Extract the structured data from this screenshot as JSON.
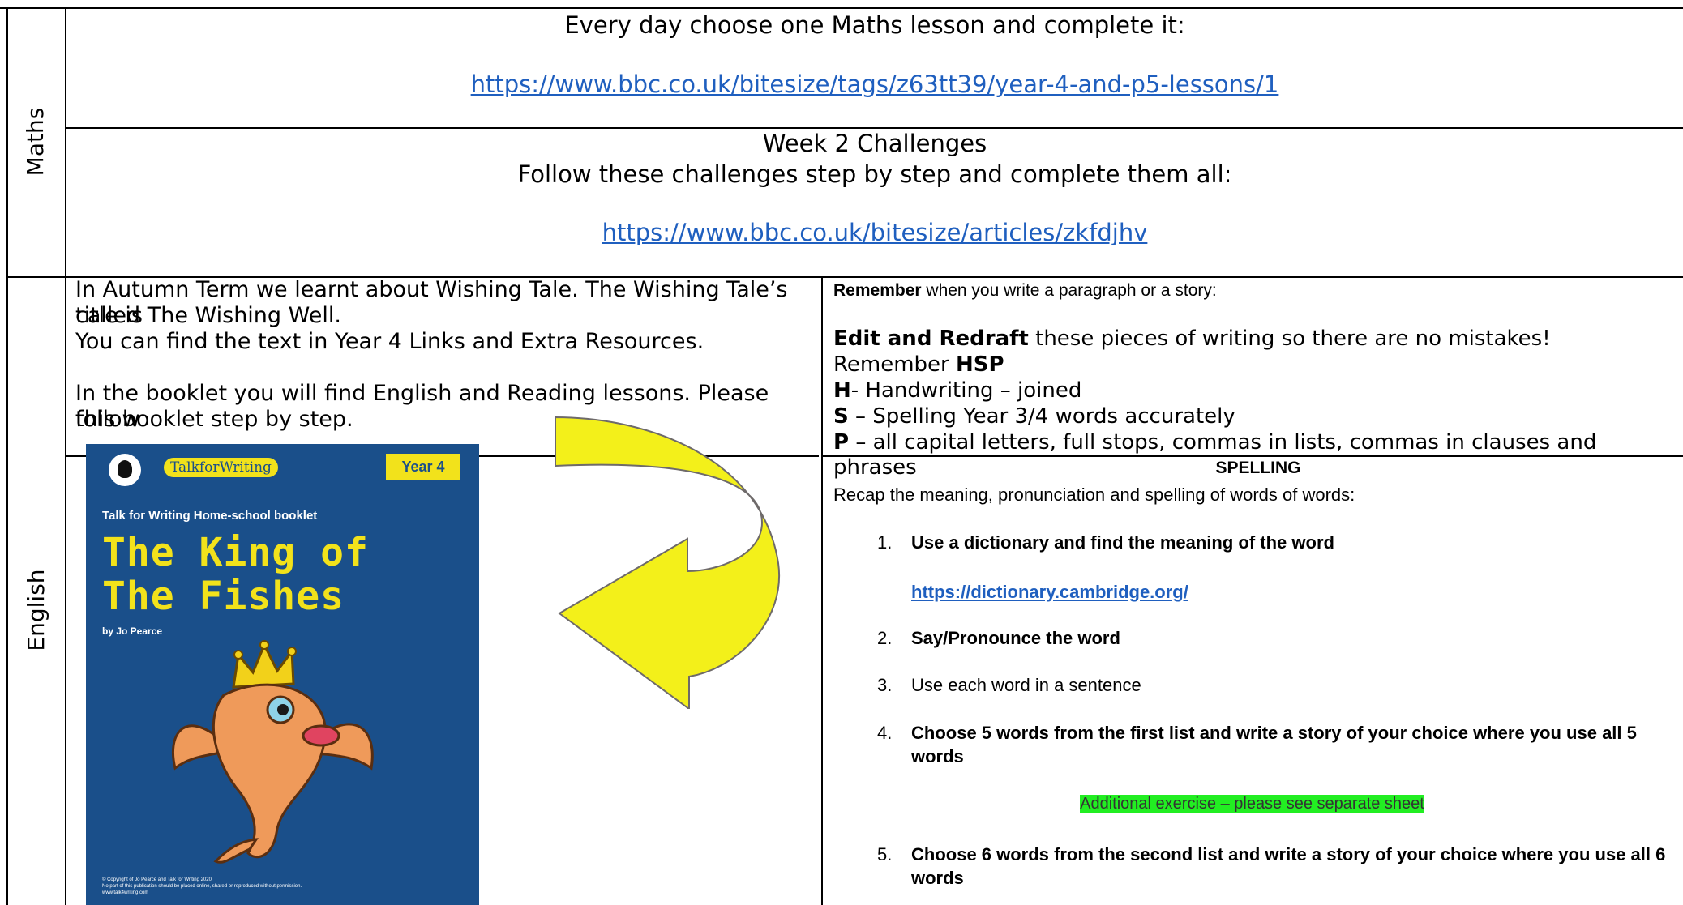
{
  "rows": {
    "maths_label": "Maths",
    "english_label": "English"
  },
  "maths": {
    "lesson_instruction": "Every day choose one Maths lesson and complete it:",
    "lesson_link": "https://www.bbc.co.uk/bitesize/tags/z63tt39/year-4-and-p5-lessons/1",
    "week_title": "Week 2 Challenges",
    "week_instruction": "Follow these challenges step by step and complete them all:",
    "week_link": "https://www.bbc.co.uk/bitesize/articles/zkfdjhv"
  },
  "english_left": {
    "line1": "In Autumn Term we learnt about Wishing Tale. The Wishing Tale’s title is",
    "line2": "called The Wishing Well.",
    "line3": "You can find the text in Year 4 Links and Extra Resources.",
    "line4": "In the booklet you will find English and Reading lessons. Please follow",
    "line5": "this booklet step by step."
  },
  "booklet": {
    "brand": "TalkforWriting",
    "year_badge": "Year 4",
    "subtitle": "Talk for Writing Home-school booklet",
    "title_line1": "The King of",
    "title_line2": "The Fishes",
    "author": "by Jo Pearce",
    "copyright1": "© Copyright of Jo Pearce and Talk for Writing 2020.",
    "copyright2": "No part of this publication should be placed online, shared or reproduced without permission.",
    "copyright3": "www.talk4writing.com",
    "colors": {
      "cover": "#1a4f8a",
      "title": "#f2e21b",
      "badge": "#f2e21b",
      "fish": "#ef9a5a"
    }
  },
  "english_right": {
    "remember_bold": "Remember",
    "remember_rest": " when you write a paragraph or a story:",
    "edit_bold": "Edit and Redraft",
    "edit_rest": " these pieces of writing so there are no mistakes!",
    "hsp_prefix": "Remember ",
    "hsp_bold": "HSP",
    "h_bold": "H",
    "h_rest": "- Handwriting – joined",
    "s_bold": "S",
    "s_rest": " – Spelling Year 3/4 words accurately",
    "p_bold": "P",
    "p_rest": " – all capital letters, full stops, commas in lists, commas in clauses and phrases"
  },
  "spelling": {
    "heading": "SPELLING",
    "intro": "Recap the meaning, pronunciation and spelling of words of words:",
    "items": [
      {
        "num": "1.",
        "text": "Use a dictionary and find the meaning of the word"
      },
      {
        "num": "2.",
        "text": "Say/Pronounce the word"
      },
      {
        "num": "3.",
        "text": "Use each word in a sentence"
      },
      {
        "num": "4.",
        "text": "Choose 5 words from the first list and write a story of your choice where you use all 5 words"
      },
      {
        "num": "5.",
        "text": "Choose 6 words from the second list and write a story of your choice where you use all 6 words"
      }
    ],
    "dictionary_link": "https://dictionary.cambridge.org/",
    "additional_exercise": "Additional exercise – please see separate sheet",
    "highlight_color": "#22ee22"
  },
  "arrow_color": "#f3f01a"
}
